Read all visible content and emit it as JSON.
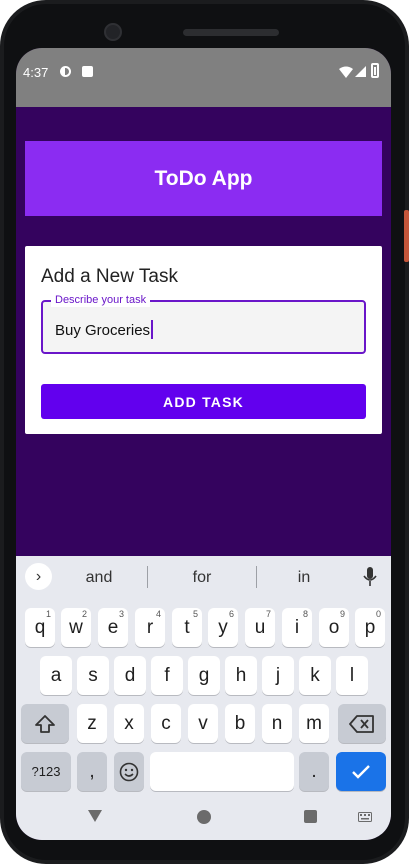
{
  "status_bar": {
    "time": "4:37"
  },
  "app": {
    "title": "ToDo App"
  },
  "card": {
    "heading": "Add a New Task",
    "field_label": "Describe your task",
    "field_value": "Buy Groceries",
    "button_label": "ADD TASK"
  },
  "colors": {
    "screen_background": "#34035e",
    "app_bar": "#8b2cf2",
    "primary_button": "#6200ee",
    "field_accent": "#6a16c9",
    "done_key": "#1a73e8"
  },
  "keyboard": {
    "suggestions": [
      "and",
      "for",
      "in"
    ],
    "row1": [
      {
        "letter": "q",
        "num": "1"
      },
      {
        "letter": "w",
        "num": "2"
      },
      {
        "letter": "e",
        "num": "3"
      },
      {
        "letter": "r",
        "num": "4"
      },
      {
        "letter": "t",
        "num": "5"
      },
      {
        "letter": "y",
        "num": "6"
      },
      {
        "letter": "u",
        "num": "7"
      },
      {
        "letter": "i",
        "num": "8"
      },
      {
        "letter": "o",
        "num": "9"
      },
      {
        "letter": "p",
        "num": "0"
      }
    ],
    "row2": [
      "a",
      "s",
      "d",
      "f",
      "g",
      "h",
      "j",
      "k",
      "l"
    ],
    "row3": [
      "z",
      "x",
      "c",
      "v",
      "b",
      "n",
      "m"
    ],
    "symbols_label": "?123",
    "comma_label": ",",
    "period_label": "."
  }
}
